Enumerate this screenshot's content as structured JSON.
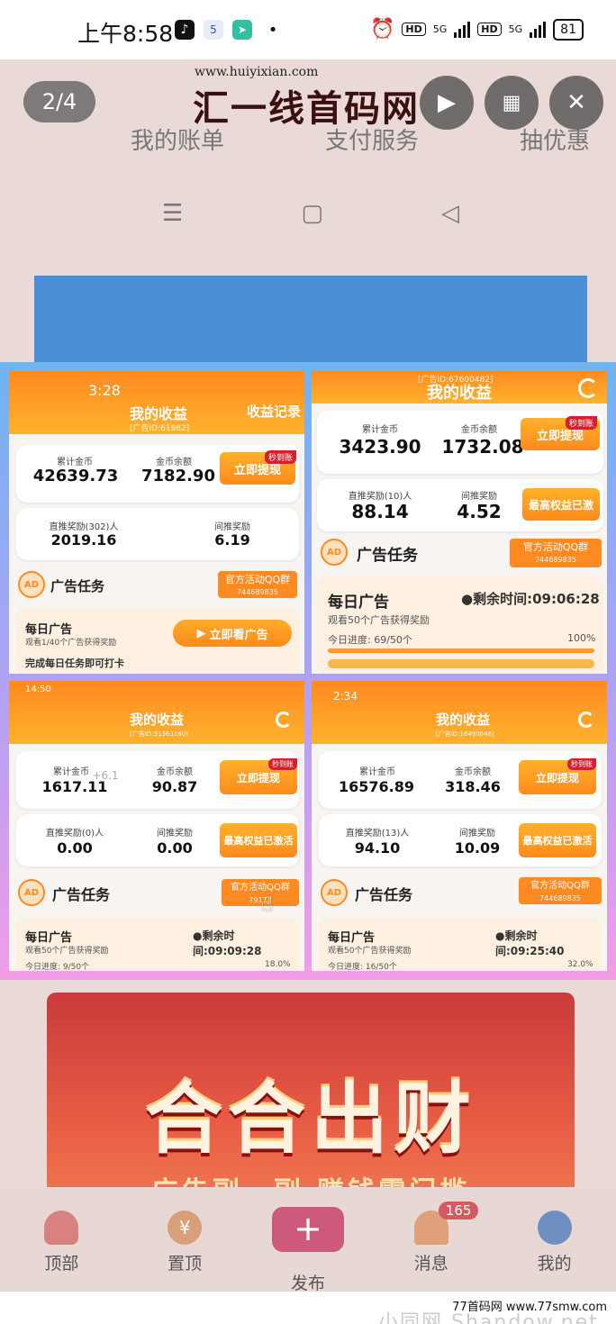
{
  "status_bar": {
    "time": "上午8:58",
    "app_badge": "5",
    "network1": "5G",
    "network2": "5G",
    "battery": "81",
    "hd": "HD"
  },
  "viewer": {
    "counter": "2/4",
    "watermark_url": "www.huiyixian.com",
    "watermark_name": "汇一线首码网"
  },
  "background_page": {
    "row": [
      "我的账单",
      "支付服务",
      "抽优惠"
    ]
  },
  "panels": [
    {
      "time": "3:28",
      "title": "我的收益",
      "ad_id": "[广告ID:61982]",
      "record": "收益记录",
      "total_label": "累计金币",
      "total": "42639.73",
      "balance_label": "金币余额",
      "balance": "7182.90",
      "withdraw": "立即提现",
      "tag": "秒到账",
      "ref_label": "直推奖励(302)人",
      "ref": "2019.16",
      "ind_label": "间推奖励",
      "ind": "6.19",
      "ad_title": "广告任务",
      "qq_label": "官方活动QQ群",
      "qq_num": "744689835",
      "daily_title": "每日广告",
      "daily_sub": "观看1/40个广告获得奖励",
      "daily_btn": "立即看广告",
      "daily_note": "完成每日任务即可打卡"
    },
    {
      "title": "我的收益",
      "ad_id": "[广告ID:67600482]",
      "total_label": "累计金币",
      "total": "3423.90",
      "balance_label": "金币余额",
      "balance": "1732.08",
      "withdraw": "立即提现",
      "tag": "秒到账",
      "ref_label": "直推奖励(10)人",
      "ref": "88.14",
      "ind_label": "间推奖励",
      "ind": "4.52",
      "rights": "最高权益已激",
      "ad_title": "广告任务",
      "qq_label": "官方活动QQ群",
      "qq_num": "744689835",
      "daily_title": "每日广告",
      "timer": "●剩余时间:09:06:28",
      "daily_sub": "观看50个广告获得奖励",
      "progress_label": "今日进度: 69/50个",
      "progress_pct": "100%"
    },
    {
      "time": "14:50",
      "title": "我的收益",
      "ad_id": "[广告ID:31363180]",
      "total_label": "累计金币",
      "total": "1617.11",
      "delta": "+6.1",
      "balance_label": "金币余额",
      "balance": "90.87",
      "withdraw": "立即提现",
      "tag": "秒到账",
      "ref_label": "直推奖励(0)人",
      "ref": "0.00",
      "ind_label": "间推奖励",
      "ind": "0.00",
      "rights": "最高权益已激活",
      "ad_title": "广告任务",
      "qq_label": "官方活动QQ群",
      "qq_num": "79173",
      "daily_title": "每日广告",
      "timer": "●剩余时间:09:09:28",
      "daily_sub": "观看50个广告获得奖励",
      "progress_label": "今日进度: 9/50个",
      "progress_pct": "18.0%"
    },
    {
      "time": "2:34",
      "title": "我的收益",
      "ad_id": "[广告ID:16490646]",
      "total_label": "累计金币",
      "total": "16576.89",
      "balance_label": "金币余额",
      "balance": "318.46",
      "withdraw": "立即提现",
      "tag": "秒到账",
      "ref_label": "直推奖励(13)人",
      "ref": "94.10",
      "ind_label": "间推奖励",
      "ind": "10.09",
      "rights": "最高权益已激活",
      "ad_title": "广告任务",
      "qq_label": "官方活动QQ群",
      "qq_num": "744689835",
      "daily_title": "每日广告",
      "timer": "●剩余时间:09:25:40",
      "daily_sub": "观看50个广告获得奖励",
      "progress_label": "今日进度: 16/50个",
      "progress_pct": "32.0%"
    }
  ],
  "poster": {
    "title": "合合出财",
    "subtitle": "广告副一副 赚钱零门槛"
  },
  "bottom_nav": [
    {
      "label": "顶部"
    },
    {
      "label": "置顶"
    },
    {
      "label": "发布"
    },
    {
      "label": "消息",
      "badge": "165"
    },
    {
      "label": "我的"
    }
  ],
  "footer": {
    "site": "77首码网 www.77smw.com",
    "shadow": "小同网 Shandow.net"
  }
}
